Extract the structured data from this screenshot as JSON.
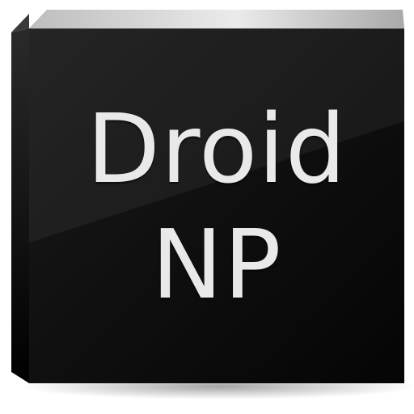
{
  "icon": {
    "name": "app-icon",
    "line1": "Droid",
    "line2": "NP"
  },
  "colors": {
    "face": "#0d0d0d",
    "edge_light": "#d0d0d0",
    "text": "#e9e9e9"
  }
}
